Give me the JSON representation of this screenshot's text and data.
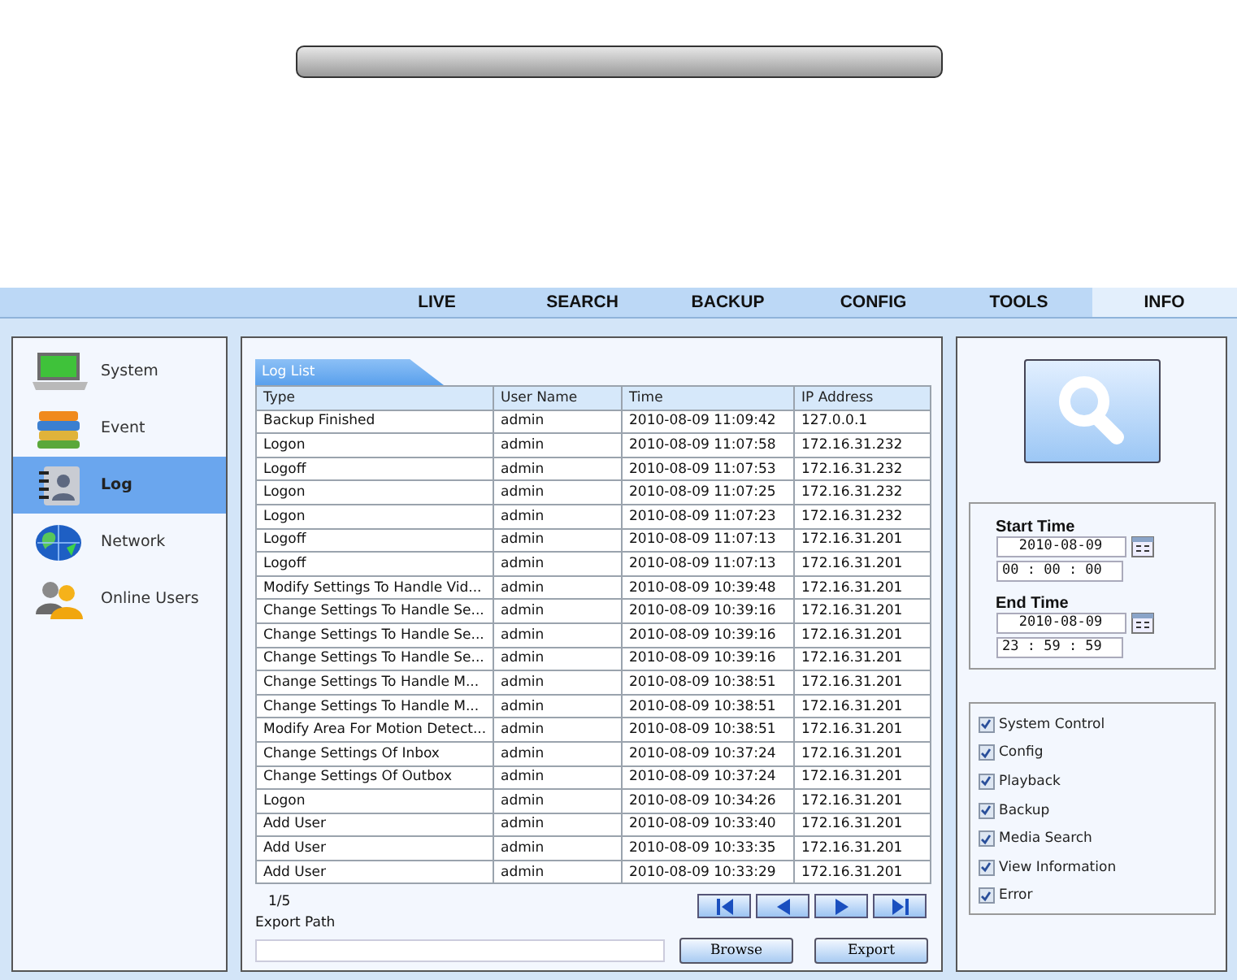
{
  "nav_tabs": [
    {
      "label": "LIVE",
      "selected": false
    },
    {
      "label": "SEARCH",
      "selected": false
    },
    {
      "label": "BACKUP",
      "selected": false
    },
    {
      "label": "CONFIG",
      "selected": false
    },
    {
      "label": "TOOLS",
      "selected": false
    },
    {
      "label": "INFO",
      "selected": true
    }
  ],
  "sidebar": {
    "items": [
      {
        "label": "System",
        "selected": false
      },
      {
        "label": "Event",
        "selected": false
      },
      {
        "label": "Log",
        "selected": true
      },
      {
        "label": "Network",
        "selected": false
      },
      {
        "label": "Online Users",
        "selected": false
      }
    ]
  },
  "log_list": {
    "tab": "Log List",
    "columns": [
      "Type",
      "User Name",
      "Time",
      "IP Address"
    ],
    "rows": [
      [
        "Backup Finished",
        "admin",
        "2010-08-09 11:09:42",
        "127.0.0.1"
      ],
      [
        "Logon",
        "admin",
        "2010-08-09 11:07:58",
        "172.16.31.232"
      ],
      [
        "Logoff",
        "admin",
        "2010-08-09 11:07:53",
        "172.16.31.232"
      ],
      [
        "Logon",
        "admin",
        "2010-08-09 11:07:25",
        "172.16.31.232"
      ],
      [
        "Logon",
        "admin",
        "2010-08-09 11:07:23",
        "172.16.31.232"
      ],
      [
        "Logoff",
        "admin",
        "2010-08-09 11:07:13",
        "172.16.31.201"
      ],
      [
        "Logoff",
        "admin",
        "2010-08-09 11:07:13",
        "172.16.31.201"
      ],
      [
        "Modify Settings To Handle Vid...",
        "admin",
        "2010-08-09 10:39:48",
        "172.16.31.201"
      ],
      [
        "Change Settings To Handle Se...",
        "admin",
        "2010-08-09 10:39:16",
        "172.16.31.201"
      ],
      [
        "Change Settings To Handle Se...",
        "admin",
        "2010-08-09 10:39:16",
        "172.16.31.201"
      ],
      [
        "Change Settings To Handle Se...",
        "admin",
        "2010-08-09 10:39:16",
        "172.16.31.201"
      ],
      [
        "Change Settings To Handle M...",
        "admin",
        "2010-08-09 10:38:51",
        "172.16.31.201"
      ],
      [
        "Change Settings To Handle M...",
        "admin",
        "2010-08-09 10:38:51",
        "172.16.31.201"
      ],
      [
        "Modify Area For Motion Detect...",
        "admin",
        "2010-08-09 10:38:51",
        "172.16.31.201"
      ],
      [
        "Change Settings Of Inbox",
        "admin",
        "2010-08-09 10:37:24",
        "172.16.31.201"
      ],
      [
        "Change Settings Of Outbox",
        "admin",
        "2010-08-09 10:37:24",
        "172.16.31.201"
      ],
      [
        "Logon",
        "admin",
        "2010-08-09 10:34:26",
        "172.16.31.201"
      ],
      [
        "Add User",
        "admin",
        "2010-08-09 10:33:40",
        "172.16.31.201"
      ],
      [
        "Add User",
        "admin",
        "2010-08-09 10:33:35",
        "172.16.31.201"
      ],
      [
        "Add User",
        "admin",
        "2010-08-09 10:33:29",
        "172.16.31.201"
      ]
    ],
    "page": "1/5",
    "export_path_label": "Export Path",
    "browse_button": "Browse",
    "export_button": "Export"
  },
  "time_filter": {
    "start_label": "Start Time",
    "start_date": "2010-08-09",
    "start_time": "00 : 00 : 00",
    "end_label": "End Time",
    "end_date": "2010-08-09",
    "end_time": "23 : 59 : 59"
  },
  "log_types": [
    {
      "label": "System Control",
      "checked": true
    },
    {
      "label": "Config",
      "checked": true
    },
    {
      "label": "Playback",
      "checked": true
    },
    {
      "label": "Backup",
      "checked": true
    },
    {
      "label": "Media Search",
      "checked": true
    },
    {
      "label": "View Information",
      "checked": true
    },
    {
      "label": "Error",
      "checked": true
    }
  ]
}
